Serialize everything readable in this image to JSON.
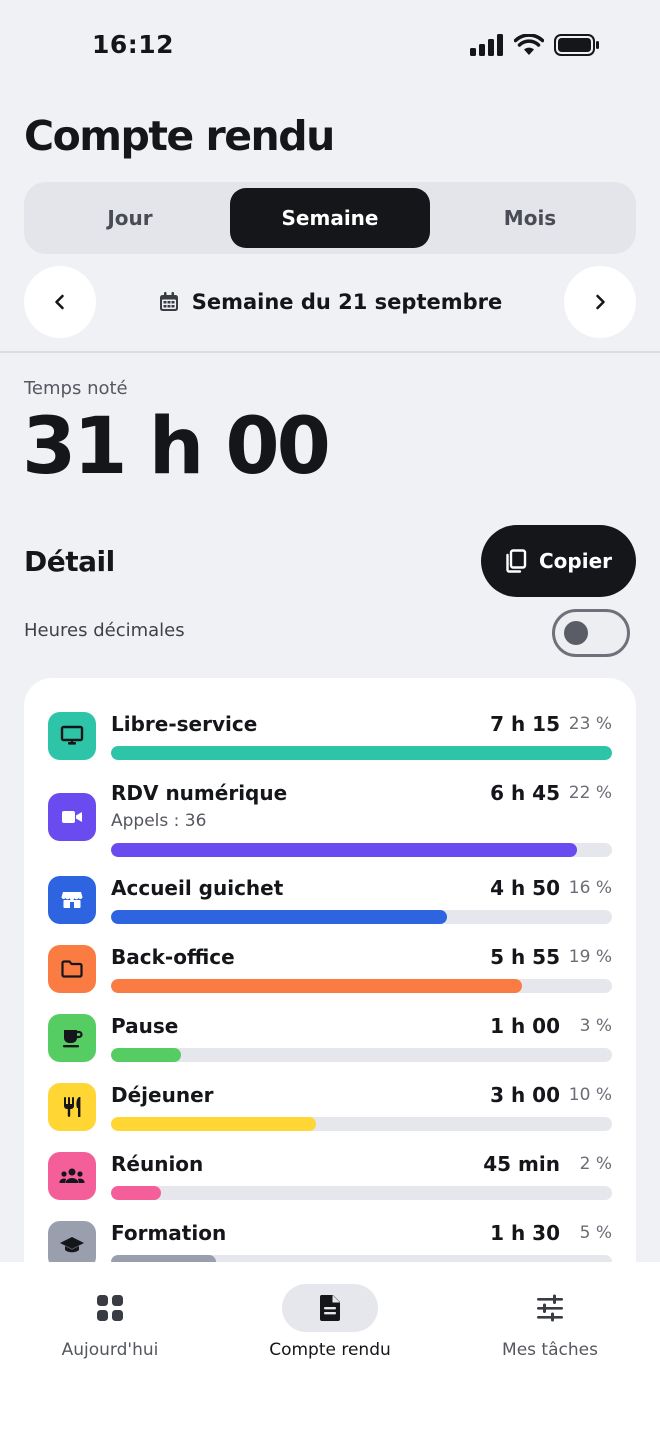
{
  "status_bar": {
    "time": "16:12"
  },
  "header": {
    "title": "Compte rendu"
  },
  "segmented": {
    "tabs": [
      "Jour",
      "Semaine",
      "Mois"
    ],
    "active": "Semaine"
  },
  "week_nav": {
    "label": "Semaine du 21 septembre"
  },
  "summary": {
    "label": "Temps noté",
    "value": "31 h 00"
  },
  "detail": {
    "title": "Détail",
    "copy_label": "Copier",
    "decimal_label": "Heures décimales",
    "decimal_enabled": false
  },
  "categories": [
    {
      "name": "Libre-service",
      "value": "7 h 15",
      "percent": "23 %",
      "progress": 1.0,
      "color": "#2ec4a8",
      "icon": "monitor-icon"
    },
    {
      "name": "RDV numérique",
      "sub": "Appels : 36",
      "value": "6 h 45",
      "percent": "22 %",
      "progress": 0.93,
      "color": "#6a4bef",
      "icon": "video-icon"
    },
    {
      "name": "Accueil guichet",
      "value": "4 h 50",
      "percent": "16 %",
      "progress": 0.67,
      "color": "#2f64e0",
      "icon": "storefront-icon"
    },
    {
      "name": "Back-office",
      "value": "5 h 55",
      "percent": "19 %",
      "progress": 0.82,
      "color": "#fb7c43",
      "icon": "folder-icon"
    },
    {
      "name": "Pause",
      "value": "1 h 00",
      "percent": "3 %",
      "progress": 0.14,
      "color": "#56cd62",
      "icon": "coffee-icon"
    },
    {
      "name": "Déjeuner",
      "value": "3 h 00",
      "percent": "10 %",
      "progress": 0.41,
      "color": "#ffd634",
      "icon": "utensils-icon"
    },
    {
      "name": "Réunion",
      "value": "45 min",
      "percent": "2 %",
      "progress": 0.1,
      "color": "#f45f9a",
      "icon": "group-icon"
    },
    {
      "name": "Formation",
      "value": "1 h 30",
      "percent": "5 %",
      "progress": 0.21,
      "color": "#9a9fae",
      "icon": "graduation-cap-icon"
    }
  ],
  "bottom_nav": {
    "tabs": [
      {
        "label": "Aujourd'hui",
        "icon": "dashboard-icon"
      },
      {
        "label": "Compte rendu",
        "icon": "document-icon"
      },
      {
        "label": "Mes tâches",
        "icon": "sliders-icon"
      }
    ],
    "active": "Compte rendu"
  }
}
